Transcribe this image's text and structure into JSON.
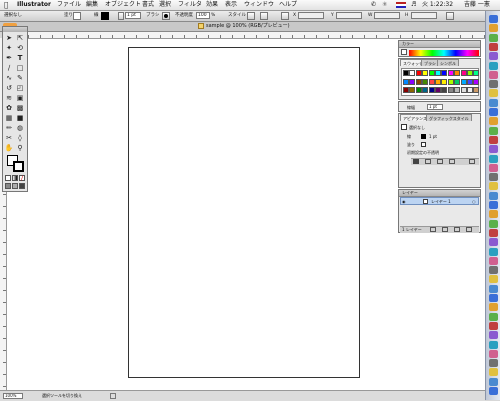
{
  "menubar": {
    "app_name": "Illustrator",
    "items": [
      "ファイル",
      "編集",
      "オブジェクト",
      "書式",
      "選択",
      "フィルタ",
      "効果",
      "表示",
      "ウィンドウ",
      "ヘルプ"
    ],
    "clock": "火 1:22:32",
    "user": "吉藤 一憲"
  },
  "control": {
    "selection_label": "選択なし",
    "fill_label": "塗り",
    "stroke_label": "線",
    "stroke_weight": "1 pt",
    "brush_label": "ブラシ",
    "style_label": "スタイル",
    "opacity_label": "不透明度",
    "opacity_value": "100",
    "opacity_unit": "%",
    "x_label": "X",
    "y_label": "Y",
    "w_label": "W",
    "h_label": "H"
  },
  "document": {
    "tab_title": "sample @ 100% (RGB/プレビュー)"
  },
  "status": {
    "zoom": "100%",
    "tool_hint": "選択ツールを切り換え"
  },
  "palettes": {
    "color": {
      "title": "カラー"
    },
    "swatches": {
      "tabs": [
        "スウォッチ",
        "ブラシ",
        "シンボル"
      ]
    },
    "stroke": {
      "weight_label": "線幅",
      "weight_value": "1 pt"
    },
    "appearance": {
      "tabs": [
        "アピアランス",
        "グラフィックスタイル"
      ],
      "selection": "選択なし",
      "stroke_label": "線",
      "stroke_value": "1 pt",
      "fill_label": "塗り",
      "opacity_label": "初期設定の不透明"
    },
    "layers": {
      "title": "レイヤー",
      "layer_name": "レイヤー 1",
      "footer": "1 レイヤー"
    }
  },
  "colors": {
    "swatches": [
      "#000000",
      "#ffffff",
      "#ff0000",
      "#ffff00",
      "#00ff00",
      "#00ffff",
      "#0000ff",
      "#ff00ff",
      "#ff8800",
      "#ff0088",
      "#88ff00",
      "#00ff88",
      "#0088ff",
      "#8800ff",
      "#884400",
      "#448800",
      "#ff4444",
      "#ffaa00",
      "#ffee00",
      "#aaff00",
      "#00cc66",
      "#00aaff",
      "#4444ff",
      "#aa00ff",
      "#880000",
      "#886600",
      "#008800",
      "#006688",
      "#000088",
      "#660066",
      "#444444",
      "#888888",
      "#bbbbbb",
      "#dddddd",
      "#eeeeee",
      "#cc9966"
    ]
  }
}
